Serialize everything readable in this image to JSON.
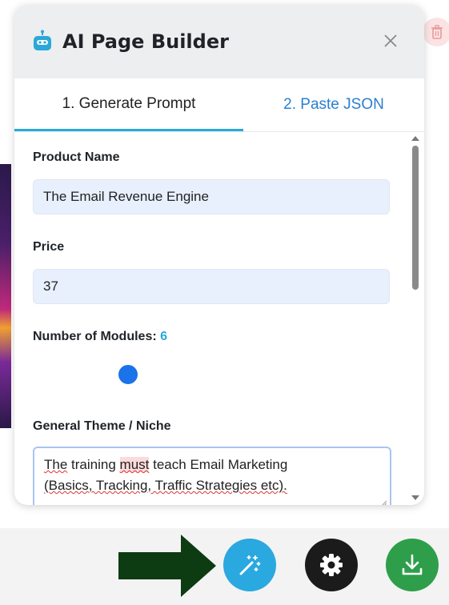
{
  "panel": {
    "title": "AI Page Builder",
    "tabs": [
      {
        "label": "1. Generate Prompt",
        "active": true
      },
      {
        "label": "2. Paste JSON",
        "active": false
      }
    ]
  },
  "form": {
    "product_name_label": "Product Name",
    "product_name_value": "The Email Revenue Engine",
    "price_label": "Price",
    "price_value": "37",
    "modules_label": "Number of Modules:",
    "modules_value": "6",
    "theme_label": "General Theme / Niche",
    "theme_value_line1_words": [
      "The",
      "training",
      "must",
      "teach",
      "Email",
      "Marketing"
    ],
    "theme_value_line2": "(Basics, Tracking, Traffic Strategies etc)."
  },
  "icons": {
    "header": "robot-icon",
    "close": "close-icon",
    "trash": "trash-icon",
    "fab_magic": "magic-wand-icon",
    "fab_settings": "gear-icon",
    "fab_download": "download-icon",
    "pointer": "right-arrow-icon"
  },
  "colors": {
    "accent": "#2aa8d8",
    "tab_inactive": "#2a7fd0",
    "slider": "#1a73e8",
    "fab_magic": "#2aa8e0",
    "fab_settings": "#1b1b1b",
    "fab_download": "#2e9e4a",
    "arrow": "#0d3b12"
  }
}
